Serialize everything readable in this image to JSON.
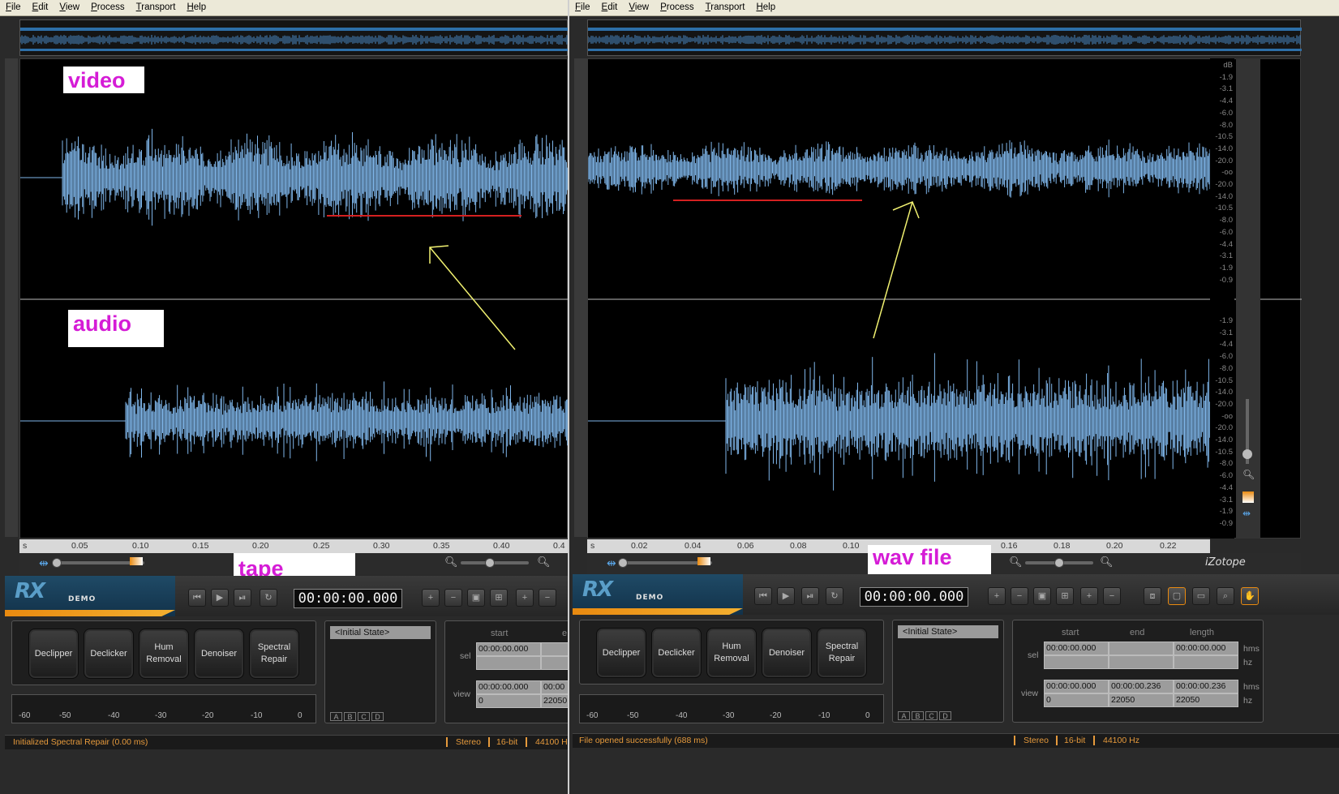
{
  "menu_items": [
    "File",
    "Edit",
    "View",
    "Process",
    "Transport",
    "Help"
  ],
  "annotations": {
    "video": "video",
    "audio": "audio",
    "tape_signal": "tape signal",
    "wav_file": "wav file"
  },
  "colors": {
    "waveform": "#7fb6ea",
    "annotation_text": "#d51cd6",
    "underline": "#d42020",
    "arrow": "#f0f070",
    "status_text": "#e69a3c"
  },
  "left": {
    "ruler_labels": [
      "s",
      "0.05",
      "0.10",
      "0.15",
      "0.20",
      "0.25",
      "0.30",
      "0.35",
      "0.40",
      "0.4"
    ],
    "timecode": "00:00:00.000",
    "modules": [
      "Declipper",
      "Declicker",
      "Hum\nRemoval",
      "Denoiser",
      "Spectral\nRepair"
    ],
    "meter_labels": [
      "-60",
      "-50",
      "-40",
      "-30",
      "-20",
      "-10",
      "0"
    ],
    "history_item": "<Initial State>",
    "abcd": [
      "A",
      "B",
      "C",
      "D"
    ],
    "sel_headers": [
      "start",
      "e"
    ],
    "sel_label": "sel",
    "view_label": "view",
    "sel_start": "00:00:00.000",
    "view_start": "00:00:00.000",
    "view_start_2": "0",
    "view_end": "00:00",
    "view_end_2": "22050",
    "status_message": "Initialized Spectral Repair (0.00 ms)",
    "status_channels": "Stereo",
    "status_bits": "16-bit",
    "status_rate": "44100 H"
  },
  "right": {
    "ruler_labels": [
      "s",
      "0.02",
      "0.04",
      "0.06",
      "0.08",
      "0.10",
      "0.16",
      "0.18",
      "0.20",
      "0.22"
    ],
    "db_top": [
      "dB",
      "-1.9",
      "-3.1",
      "-4.4",
      "-6.0",
      "-8.0",
      "-10.5",
      "-14.0",
      "-20.0",
      "-oo",
      "-20.0",
      "-14.0",
      "-10.5",
      "-8.0",
      "-6.0",
      "-4.4",
      "-3.1",
      "-1.9",
      "-0.9"
    ],
    "db_bottom": [
      "-1.9",
      "-3.1",
      "-4.4",
      "-6.0",
      "-8.0",
      "-10.5",
      "-14.0",
      "-20.0",
      "-oo",
      "-20.0",
      "-14.0",
      "-10.5",
      "-8.0",
      "-6.0",
      "-4.4",
      "-3.1",
      "-1.9",
      "-0.9"
    ],
    "timecode": "00:00:00.000",
    "modules": [
      "Declipper",
      "Declicker",
      "Hum\nRemoval",
      "Denoiser",
      "Spectral\nRepair"
    ],
    "meter_labels": [
      "-60",
      "-50",
      "-40",
      "-30",
      "-20",
      "-10",
      "0"
    ],
    "history_item": "<Initial State>",
    "abcd": [
      "A",
      "B",
      "C",
      "D"
    ],
    "sel_headers": [
      "start",
      "end",
      "length"
    ],
    "sel_label": "sel",
    "view_label": "view",
    "units_hms": "hms",
    "units_hz": "hz",
    "sel_start": "00:00:00.000",
    "sel_length": "00:00:00.000",
    "view_start": "00:00:00.000",
    "view_end": "00:00:00.236",
    "view_length": "00:00:00.236",
    "view_start_2": "0",
    "view_end_2": "22050",
    "view_length_2": "22050",
    "brand_name": "iZotope",
    "status_message": "File opened successfully (688 ms)",
    "status_channels": "Stereo",
    "status_bits": "16-bit",
    "status_rate": "44100 Hz"
  },
  "brand_logo": "RX",
  "brand_demo": "DEMO"
}
